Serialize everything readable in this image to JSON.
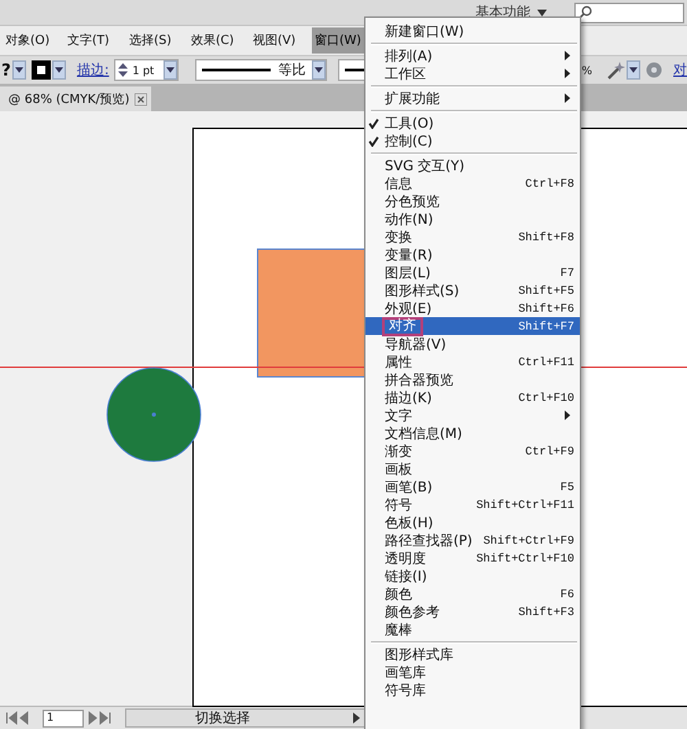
{
  "app_bar": {
    "workspace": "基本功能"
  },
  "menu_bar": [
    {
      "label": "对象(O)",
      "selected": false
    },
    {
      "label": "文字(T)",
      "selected": false
    },
    {
      "label": "选择(S)",
      "selected": false
    },
    {
      "label": "效果(C)",
      "selected": false
    },
    {
      "label": "视图(V)",
      "selected": false
    },
    {
      "label": "窗口(W)",
      "selected": true
    }
  ],
  "control_bar": {
    "fill_hint": "?",
    "stroke_label": "描边:",
    "stroke_weight": "1 pt",
    "profile": "等比",
    "opacity_unit": "%",
    "align_link": "对"
  },
  "document_tab": {
    "title": "@ 68% (CMYK/预览)"
  },
  "menu": [
    {
      "kind": "item",
      "label": "新建窗口(W)",
      "checked": false,
      "selected": false,
      "marked": false,
      "submenu": false
    },
    {
      "kind": "separator"
    },
    {
      "kind": "item",
      "label": "排列(A)",
      "checked": false,
      "selected": false,
      "marked": false,
      "submenu": true
    },
    {
      "kind": "item",
      "label": "工作区",
      "checked": false,
      "selected": false,
      "marked": false,
      "submenu": true
    },
    {
      "kind": "separator"
    },
    {
      "kind": "item",
      "label": "扩展功能",
      "checked": false,
      "selected": false,
      "marked": false,
      "submenu": true
    },
    {
      "kind": "separator"
    },
    {
      "kind": "item",
      "label": "工具(O)",
      "checked": true,
      "selected": false,
      "marked": false,
      "submenu": false
    },
    {
      "kind": "item",
      "label": "控制(C)",
      "checked": true,
      "selected": false,
      "marked": false,
      "submenu": false
    },
    {
      "kind": "separator"
    },
    {
      "kind": "item",
      "label": "SVG 交互(Y)",
      "checked": false,
      "selected": false,
      "marked": false,
      "submenu": false
    },
    {
      "kind": "item",
      "label": "信息",
      "shortcut": "Ctrl+F8",
      "checked": false,
      "selected": false,
      "marked": false,
      "submenu": false
    },
    {
      "kind": "item",
      "label": "分色预览",
      "checked": false,
      "selected": false,
      "marked": false,
      "submenu": false
    },
    {
      "kind": "item",
      "label": "动作(N)",
      "checked": false,
      "selected": false,
      "marked": false,
      "submenu": false
    },
    {
      "kind": "item",
      "label": "变换",
      "shortcut": "Shift+F8",
      "checked": false,
      "selected": false,
      "marked": false,
      "submenu": false
    },
    {
      "kind": "item",
      "label": "变量(R)",
      "checked": false,
      "selected": false,
      "marked": false,
      "submenu": false
    },
    {
      "kind": "item",
      "label": "图层(L)",
      "shortcut": "F7",
      "checked": false,
      "selected": false,
      "marked": false,
      "submenu": false
    },
    {
      "kind": "item",
      "label": "图形样式(S)",
      "shortcut": "Shift+F5",
      "checked": false,
      "selected": false,
      "marked": false,
      "submenu": false
    },
    {
      "kind": "item",
      "label": "外观(E)",
      "shortcut": "Shift+F6",
      "checked": false,
      "selected": false,
      "marked": false,
      "submenu": false
    },
    {
      "kind": "item",
      "label": "对齐",
      "shortcut": "Shift+F7",
      "checked": false,
      "selected": true,
      "marked": true,
      "submenu": false
    },
    {
      "kind": "item",
      "label": "导航器(V)",
      "checked": false,
      "selected": false,
      "marked": false,
      "submenu": false
    },
    {
      "kind": "item",
      "label": "属性",
      "shortcut": "Ctrl+F11",
      "checked": false,
      "selected": false,
      "marked": false,
      "submenu": false
    },
    {
      "kind": "item",
      "label": "拼合器预览",
      "checked": false,
      "selected": false,
      "marked": false,
      "submenu": false
    },
    {
      "kind": "item",
      "label": "描边(K)",
      "shortcut": "Ctrl+F10",
      "checked": false,
      "selected": false,
      "marked": false,
      "submenu": false
    },
    {
      "kind": "item",
      "label": "文字",
      "checked": false,
      "selected": false,
      "marked": false,
      "submenu": true
    },
    {
      "kind": "item",
      "label": "文档信息(M)",
      "checked": false,
      "selected": false,
      "marked": false,
      "submenu": false
    },
    {
      "kind": "item",
      "label": "渐变",
      "shortcut": "Ctrl+F9",
      "checked": false,
      "selected": false,
      "marked": false,
      "submenu": false
    },
    {
      "kind": "item",
      "label": "画板",
      "checked": false,
      "selected": false,
      "marked": false,
      "submenu": false
    },
    {
      "kind": "item",
      "label": "画笔(B)",
      "shortcut": "F5",
      "checked": false,
      "selected": false,
      "marked": false,
      "submenu": false
    },
    {
      "kind": "item",
      "label": "符号",
      "shortcut": "Shift+Ctrl+F11",
      "checked": false,
      "selected": false,
      "marked": false,
      "submenu": false
    },
    {
      "kind": "item",
      "label": "色板(H)",
      "checked": false,
      "selected": false,
      "marked": false,
      "submenu": false
    },
    {
      "kind": "item",
      "label": "路径查找器(P)",
      "shortcut": "Shift+Ctrl+F9",
      "checked": false,
      "selected": false,
      "marked": false,
      "submenu": false
    },
    {
      "kind": "item",
      "label": "透明度",
      "shortcut": "Shift+Ctrl+F10",
      "checked": false,
      "selected": false,
      "marked": false,
      "submenu": false
    },
    {
      "kind": "item",
      "label": "链接(I)",
      "checked": false,
      "selected": false,
      "marked": false,
      "submenu": false
    },
    {
      "kind": "item",
      "label": "颜色",
      "shortcut": "F6",
      "checked": false,
      "selected": false,
      "marked": false,
      "submenu": false
    },
    {
      "kind": "item",
      "label": "颜色参考",
      "shortcut": "Shift+F3",
      "checked": false,
      "selected": false,
      "marked": false,
      "submenu": false
    },
    {
      "kind": "item",
      "label": "魔棒",
      "checked": false,
      "selected": false,
      "marked": false,
      "submenu": false
    },
    {
      "kind": "separator"
    },
    {
      "kind": "item",
      "label": "图形样式库",
      "checked": false,
      "selected": false,
      "marked": false,
      "submenu": false
    },
    {
      "kind": "item",
      "label": "画笔库",
      "checked": false,
      "selected": false,
      "marked": false,
      "submenu": false
    },
    {
      "kind": "item",
      "label": "符号库",
      "checked": false,
      "selected": false,
      "marked": false,
      "submenu": false
    }
  ],
  "status_bar": {
    "page": "1",
    "info": "切换选择"
  }
}
